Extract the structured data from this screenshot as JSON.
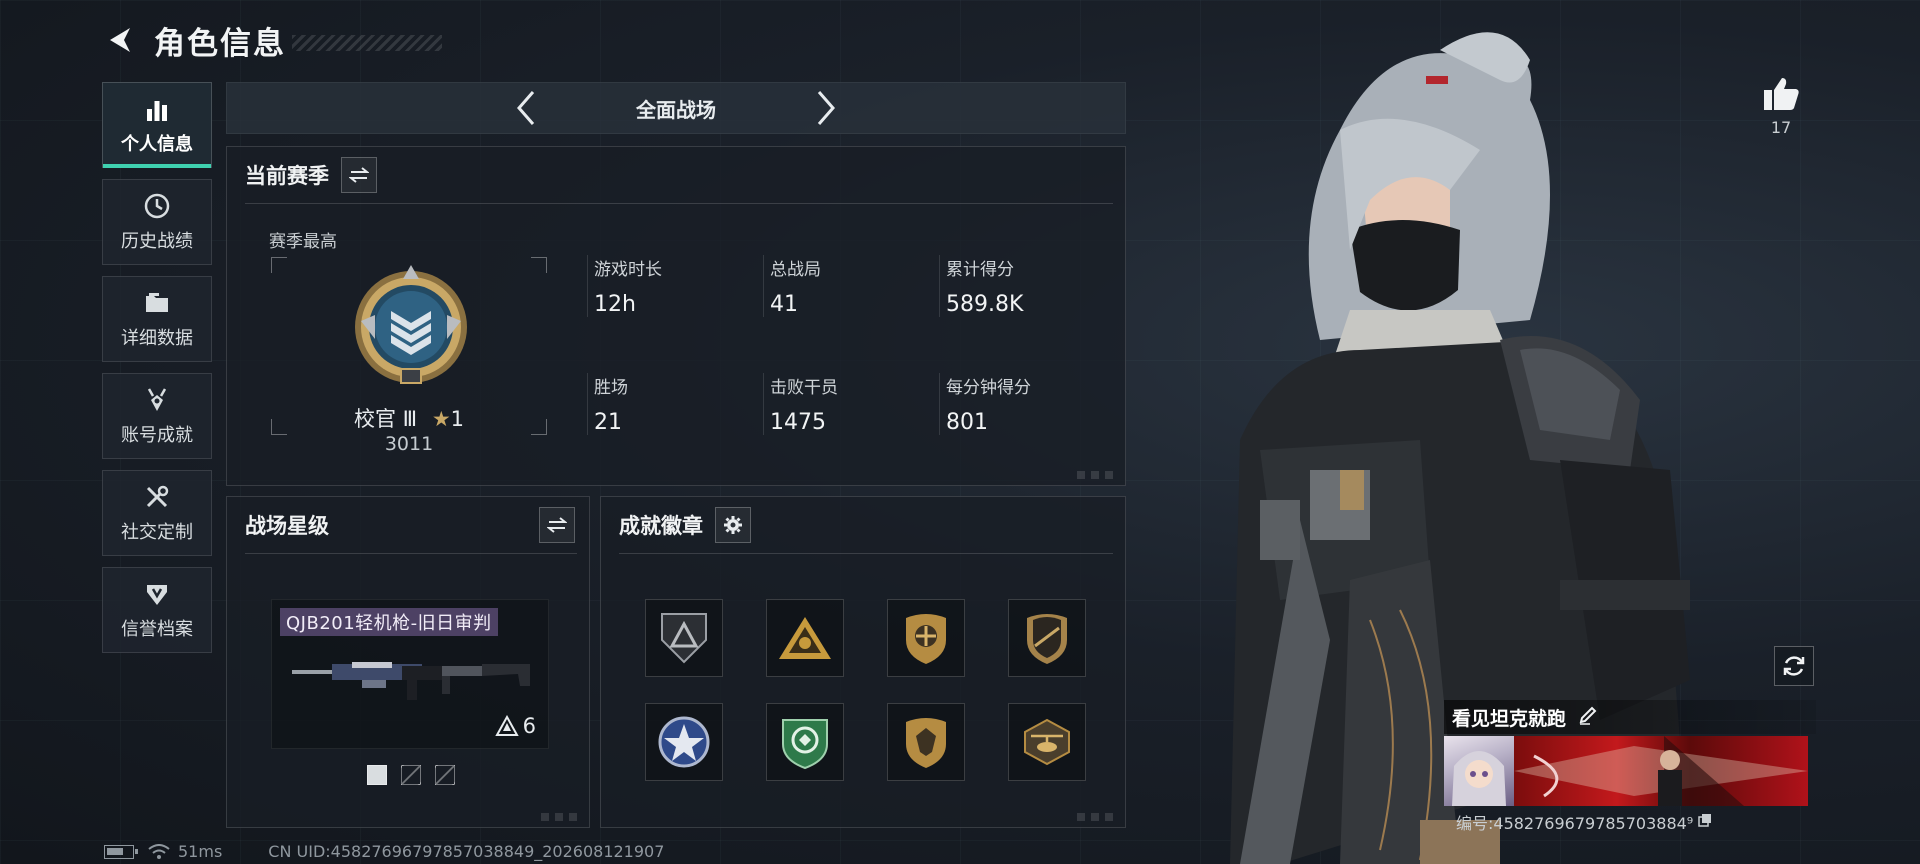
{
  "header": {
    "title": "角色信息"
  },
  "sidebar": {
    "items": [
      {
        "label": "个人信息",
        "active": true
      },
      {
        "label": "历史战绩"
      },
      {
        "label": "详细数据"
      },
      {
        "label": "账号成就"
      },
      {
        "label": "社交定制"
      },
      {
        "label": "信誉档案"
      }
    ]
  },
  "mode": {
    "title": "全面战场"
  },
  "season": {
    "title": "当前赛季",
    "subtitle": "赛季最高",
    "rank_name": "校官 Ⅲ",
    "rank_stars": "1",
    "rank_score": "3011",
    "stats": [
      {
        "label": "游戏时长",
        "value": "12h"
      },
      {
        "label": "总战局",
        "value": "41"
      },
      {
        "label": "累计得分",
        "value": "589.8K"
      },
      {
        "label": "胜场",
        "value": "21"
      },
      {
        "label": "击败干员",
        "value": "1475"
      },
      {
        "label": "每分钟得分",
        "value": "801"
      }
    ]
  },
  "star_level": {
    "title": "战场星级",
    "weapon_name": "QJB201轻机枪-旧日审判",
    "weapon_level": "6"
  },
  "achievements": {
    "title": "成就徽章"
  },
  "like": {
    "count": "17"
  },
  "profile": {
    "name": "看见坦克就跑",
    "id_text": "编号:4582769679785703884⁹"
  },
  "footer": {
    "ping": "51ms",
    "uid": "CN UID:45827696797857038849_202608121907"
  },
  "colors": {
    "accent": "#3fd1b0",
    "background": "#161b22"
  }
}
